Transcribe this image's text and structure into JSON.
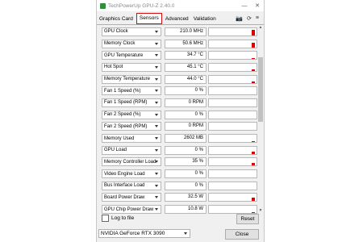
{
  "window": {
    "title": "TechPowerUp GPU-Z 2.40.0",
    "minimize": "—",
    "close": "✕"
  },
  "tabs": [
    {
      "label": "Graphics Card"
    },
    {
      "label": "Sensors"
    },
    {
      "label": "Advanced"
    },
    {
      "label": "Validation"
    }
  ],
  "toolbar": {
    "camera_icon": "📷",
    "refresh_icon": "⟳",
    "menu_icon": "≡"
  },
  "sensors": [
    {
      "label": "GPU Clock",
      "value": "210.0 MHz",
      "level": 0.8
    },
    {
      "label": "Memory Clock",
      "value": "50.6 MHz",
      "level": 0.7
    },
    {
      "label": "GPU Temperature",
      "value": "34.7 °C",
      "level": 0.15
    },
    {
      "label": "Hot Spot",
      "value": "45.1 °C",
      "level": 0.2
    },
    {
      "label": "Memory Temperature",
      "value": "44.0 °C",
      "level": 0.25
    },
    {
      "label": "Fan 1 Speed (%)",
      "value": "0 %",
      "level": 0
    },
    {
      "label": "Fan 1 Speed (RPM)",
      "value": "0 RPM",
      "level": 0
    },
    {
      "label": "Fan 2 Speed (%)",
      "value": "0 %",
      "level": 0
    },
    {
      "label": "Fan 2 Speed (RPM)",
      "value": "0 RPM",
      "level": 0
    },
    {
      "label": "Memory Used",
      "value": "2602 MB",
      "level": 0.12
    },
    {
      "label": "GPU Load",
      "value": "0 %",
      "level": 0.3
    },
    {
      "label": "Memory Controller Load",
      "value": "35 %",
      "level": 0.35
    },
    {
      "label": "Video Engine Load",
      "value": "0 %",
      "level": 0
    },
    {
      "label": "Bus Interface Load",
      "value": "0 %",
      "level": 0
    },
    {
      "label": "Board Power Draw",
      "value": "32.5 W",
      "level": 0.4
    },
    {
      "label": "GPU Chip Power Draw",
      "value": "10.8 W",
      "level": 0.1
    }
  ],
  "footer": {
    "log_label": "Log to file",
    "reset_label": "Reset",
    "gpu_name": "NVIDIA GeForce RTX 3090",
    "close_label": "Close"
  }
}
